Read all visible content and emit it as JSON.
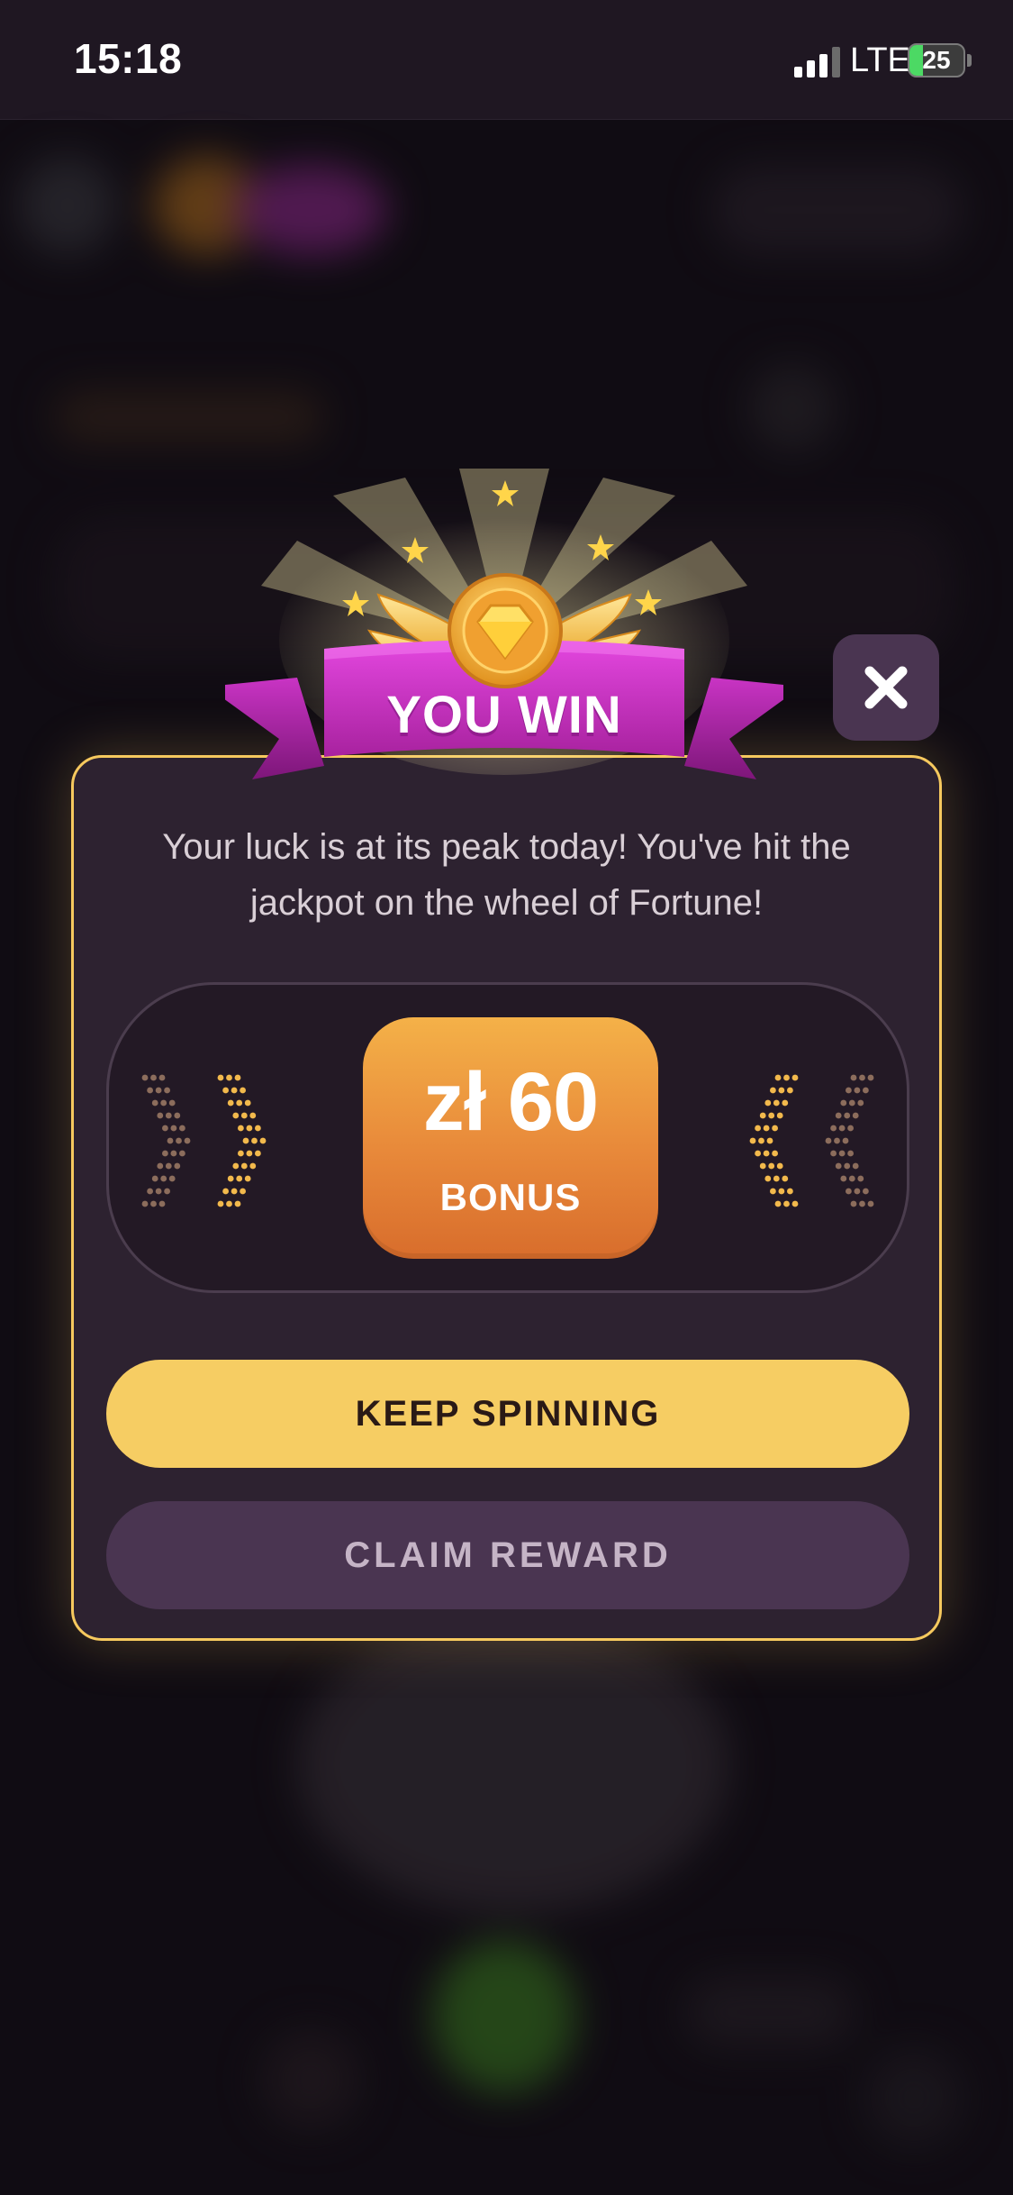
{
  "status_bar": {
    "time": "15:18",
    "network": "LTE",
    "battery_level": "25",
    "battery_fraction": 0.25,
    "signal_bars_active": 3,
    "signal_bars_total": 4
  },
  "win_modal": {
    "banner_title": "YOU WIN",
    "message": "Your luck is at its peak today! You've hit the jackpot on the wheel of Fortune!",
    "reward": {
      "amount": "zł 60",
      "label": "BONUS"
    },
    "keep_spinning_label": "KEEP SPINNING",
    "claim_reward_label": "CLAIM REWARD",
    "close_icon": "close-icon",
    "badge_icon": "diamond-coin-icon"
  },
  "colors": {
    "modal_border": "#f6c95e",
    "modal_background": "#2d2230",
    "ribbon": "#c22cc4",
    "bonus_gradient_top": "#f4b148",
    "bonus_gradient_bottom": "#d86d2c",
    "primary_button": "#f6cd63",
    "secondary_button": "#4a3551"
  }
}
